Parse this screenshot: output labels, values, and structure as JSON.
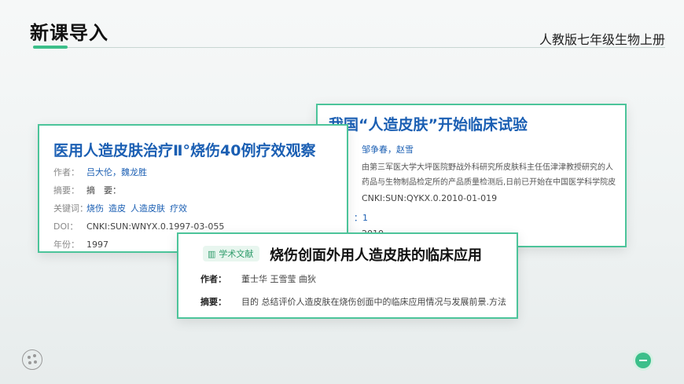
{
  "header": {
    "title": "新课导入",
    "subtitle": "人教版七年级生物上册"
  },
  "card_a": {
    "title": "我国“人造皮肤”开始临床试验",
    "authors": "邹争春，赵雪",
    "abstract_line1": "由第三军医大学大坪医院野战外科研究所皮肤科主任伍津津教授研究的人",
    "abstract_line2": "药品与生物制品检定所的产品质量检测后,日前已开始在中国医学科学院皮",
    "doi": "CNKI:SUN:QYKX.0.2010-01-019",
    "hidden_label": "：1",
    "hidden_year": "2010"
  },
  "card_b": {
    "title": "医用人造皮肤治疗Ⅱ°烧伤40例疗效观察",
    "labels": {
      "author": "作者：",
      "abstract": "摘要：",
      "keywords": "关键词：",
      "doi": "DOI：",
      "year": "年份："
    },
    "author": "吕大伦，魏龙胜",
    "abstract": "摘　要：",
    "keywords": [
      "烧伤",
      "造皮",
      "人造皮肤",
      "疗效"
    ],
    "doi": "CNKI:SUN:WNYX.0.1997-03-055",
    "year": "1997"
  },
  "card_c": {
    "badge": "学术文献",
    "badge_icon": "books-icon",
    "title": "烧伤创面外用人造皮肤的临床应用",
    "author_label": "作者：",
    "author": "董士华 王雪莹 曲狄",
    "abstract_label": "摘要：",
    "abstract": "目的 总结评价人造皮肤在烧伤创面中的临床应用情况与发展前景.方法"
  },
  "colors": {
    "accent": "#3bbf8a",
    "link": "#1b5fb3"
  }
}
